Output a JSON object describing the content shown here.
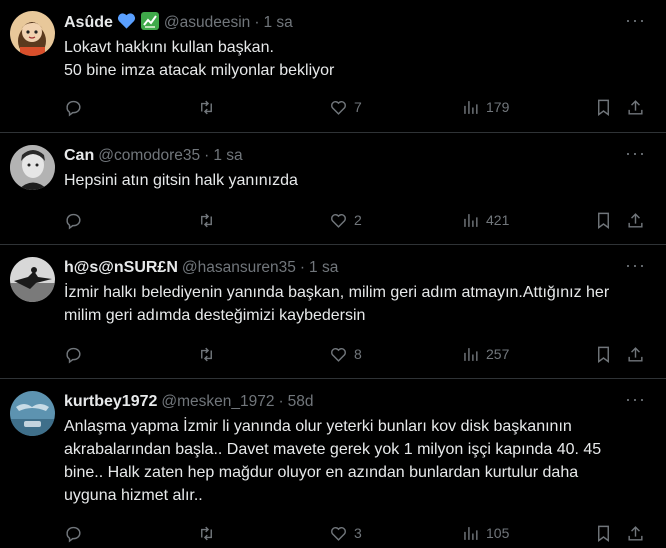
{
  "tweets": [
    {
      "name": "Asûde",
      "badges": [
        "blue-heart",
        "chart-emoji"
      ],
      "handle": "@asudeesin",
      "time": "1 sa",
      "lines": [
        "Lokavt hakkını kullan başkan.",
        "50 bine imza atacak milyonlar bekliyor"
      ],
      "reply_count": "",
      "retweet_count": "",
      "like_count": "7",
      "view_count": "179"
    },
    {
      "name": "Can",
      "handle": "@comodore35",
      "time": "1 sa",
      "lines": [
        "Hepsini atın gitsin halk yanınızda"
      ],
      "reply_count": "",
      "retweet_count": "",
      "like_count": "2",
      "view_count": "421"
    },
    {
      "name": "h@s@nSUR£N",
      "handle": "@hasansuren35",
      "time": "1 sa",
      "lines": [
        "İzmir halkı belediyenin yanında başkan, milim geri adım atmayın.Attığınız her",
        "milim geri adımda desteğimizi kaybedersin"
      ],
      "reply_count": "",
      "retweet_count": "",
      "like_count": "8",
      "view_count": "257"
    },
    {
      "name": "kurtbey1972",
      "handle": "@mesken_1972",
      "time": "58d",
      "lines": [
        "Anlaşma yapma İzmir li yanında olur yeterki bunları kov disk başkanının",
        "akrabalarından başla.. Davet mavete gerek yok 1 milyon işçi kapında 40. 45",
        "bine.. Halk zaten hep mağdur oluyor en azından bunlardan kurtulur daha",
        "uyguna hizmet alır.."
      ],
      "reply_count": "",
      "retweet_count": "",
      "like_count": "3",
      "view_count": "105"
    }
  ],
  "dot": "·",
  "more_glyph": "···",
  "icons": [
    "reply-icon",
    "retweet-icon",
    "like-icon",
    "views-icon",
    "bookmark-icon",
    "share-icon"
  ],
  "colors": {
    "background": "#000000",
    "text": "#e7e9ea",
    "muted": "#71767b",
    "divider": "#2f3336",
    "heart": "#5aa0ff",
    "chart_badge": "#3fa94a"
  }
}
